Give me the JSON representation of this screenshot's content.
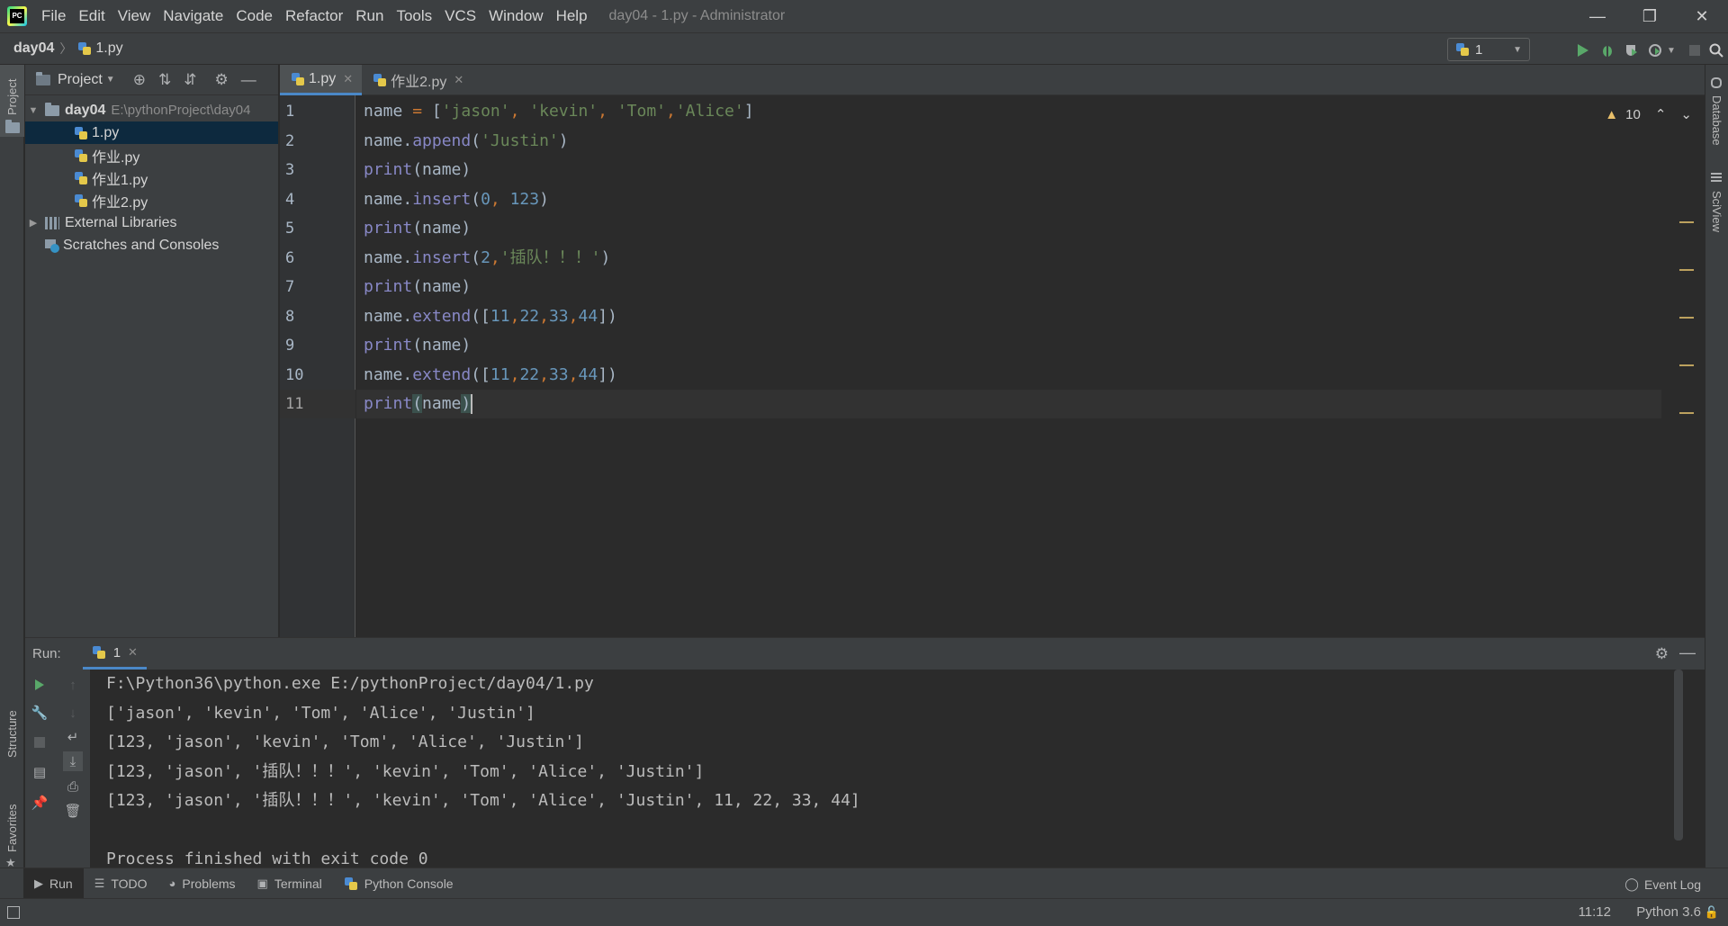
{
  "titlebar": {
    "menus": [
      "File",
      "Edit",
      "View",
      "Navigate",
      "Code",
      "Refactor",
      "Run",
      "Tools",
      "VCS",
      "Window",
      "Help"
    ],
    "window_title": "day04 - 1.py - Administrator",
    "minimize": "—",
    "restore": "❐",
    "close": "✕"
  },
  "navbar": {
    "project": "day04",
    "separator": "〉",
    "file": "1.py",
    "run_config": "1"
  },
  "left_strip": {
    "project_label": "Project",
    "structure_label": "Structure",
    "favorites_label": "Favorites"
  },
  "project_panel": {
    "title": "Project",
    "root": {
      "name": "day04",
      "path": "E:\\pythonProject\\day04"
    },
    "files": [
      "1.py",
      "作业.py",
      "作业1.py",
      "作业2.py"
    ],
    "selected_index": 0,
    "external_libraries": "External Libraries",
    "scratches": "Scratches and Consoles"
  },
  "editor": {
    "tabs": [
      "1.py",
      "作业2.py"
    ],
    "active_tab": 0,
    "warnings_count": "10",
    "line_numbers": [
      "1",
      "2",
      "3",
      "4",
      "5",
      "6",
      "7",
      "8",
      "9",
      "10",
      "11"
    ],
    "current_line": 11,
    "code": {
      "l1": {
        "a": "name ",
        "op": "=",
        "b": " [",
        "s1": "'jason'",
        "c1": ", ",
        "s2": "'kevin'",
        "c2": ", ",
        "s3": "'Tom'",
        "c3": ",",
        "s4": "'Alice'",
        "e": "]"
      },
      "l2": {
        "a": "name.",
        "fn": "append",
        "b": "(",
        "s": "'Justin'",
        "e": ")"
      },
      "print_kw": "print",
      "print_args": "(name)",
      "l4": {
        "a": "name.",
        "fn": "insert",
        "b": "(",
        "n": "0",
        "c": ", ",
        "n2": "123",
        "e": ")"
      },
      "l6": {
        "a": "name.",
        "fn": "insert",
        "b": "(",
        "n": "2",
        "c": ",",
        "s": "'插队！！！'",
        "e": ")"
      },
      "extend": {
        "a": "name.",
        "fn": "extend",
        "b": "([",
        "n1": "11",
        "n2": "22",
        "n3": "33",
        "n4": "44",
        "comma": ",",
        "e": "])"
      },
      "l11": {
        "open": "(",
        "arg": "name",
        "close": ")"
      }
    }
  },
  "right_strip": {
    "database_label": "Database",
    "sciview_label": "SciView"
  },
  "run_panel": {
    "label": "Run:",
    "tab": "1",
    "console": [
      "F:\\Python36\\python.exe E:/pythonProject/day04/1.py",
      "['jason', 'kevin', 'Tom', 'Alice', 'Justin']",
      "[123, 'jason', 'kevin', 'Tom', 'Alice', 'Justin']",
      "[123, 'jason', '插队！！！', 'kevin', 'Tom', 'Alice', 'Justin']",
      "[123, 'jason', '插队！！！', 'kevin', 'Tom', 'Alice', 'Justin', 11, 22, 33, 44]",
      "",
      "Process finished with exit code 0"
    ]
  },
  "tool_windows": [
    "Run",
    "TODO",
    "Problems",
    "Terminal",
    "Python Console"
  ],
  "event_log": "Event Log",
  "status": {
    "position": "11:12",
    "interpreter": "Python 3.6"
  },
  "colors": {
    "accent": "#4a88c7",
    "run_green": "#59a869",
    "string": "#6a8759",
    "builtin": "#8888c6",
    "number": "#6897bb"
  }
}
